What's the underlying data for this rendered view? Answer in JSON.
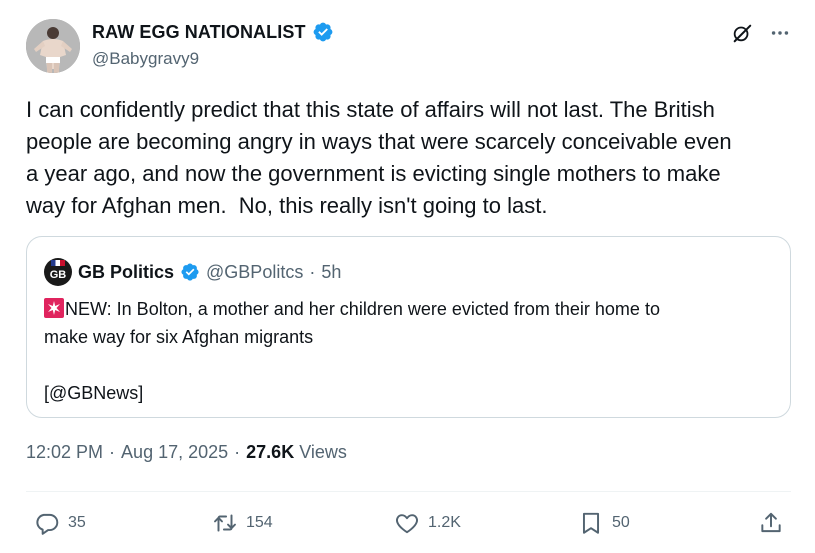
{
  "author": {
    "display_name": "RAW EGG NATIONALIST",
    "handle": "@Babygravy9",
    "verified": true
  },
  "tweet_text_lines": [
    "I can confidently predict that this state of affairs will not last. The British",
    "people are becoming angry in ways that were scarcely conceivable even",
    "a year ago, and now the government is evicting single mothers to make",
    "way for Afghan men.  No, this really isn't going to last."
  ],
  "quote": {
    "avatar_text": "GB",
    "display_name": "GB Politics",
    "handle": "@GBPolitcs",
    "separator": "·",
    "time": "5h",
    "text_line_1": "NEW: In Bolton, a mother and her children were evicted from their home to",
    "text_line_2": "make way for six Afghan migrants",
    "text_line_3": "[@GBNews]"
  },
  "meta": {
    "time": "12:02 PM",
    "dot1": "·",
    "date": "Aug 17, 2025",
    "dot2": "·",
    "views_count": "27.6K",
    "views_label": "Views"
  },
  "actions": {
    "replies": "35",
    "reposts": "154",
    "likes": "1.2K",
    "bookmarks": "50"
  },
  "colors": {
    "verified_blue": "#1d9bf0",
    "secondary_text": "#536471",
    "border": "#cfd9de",
    "siren_red": "#e0245e"
  }
}
